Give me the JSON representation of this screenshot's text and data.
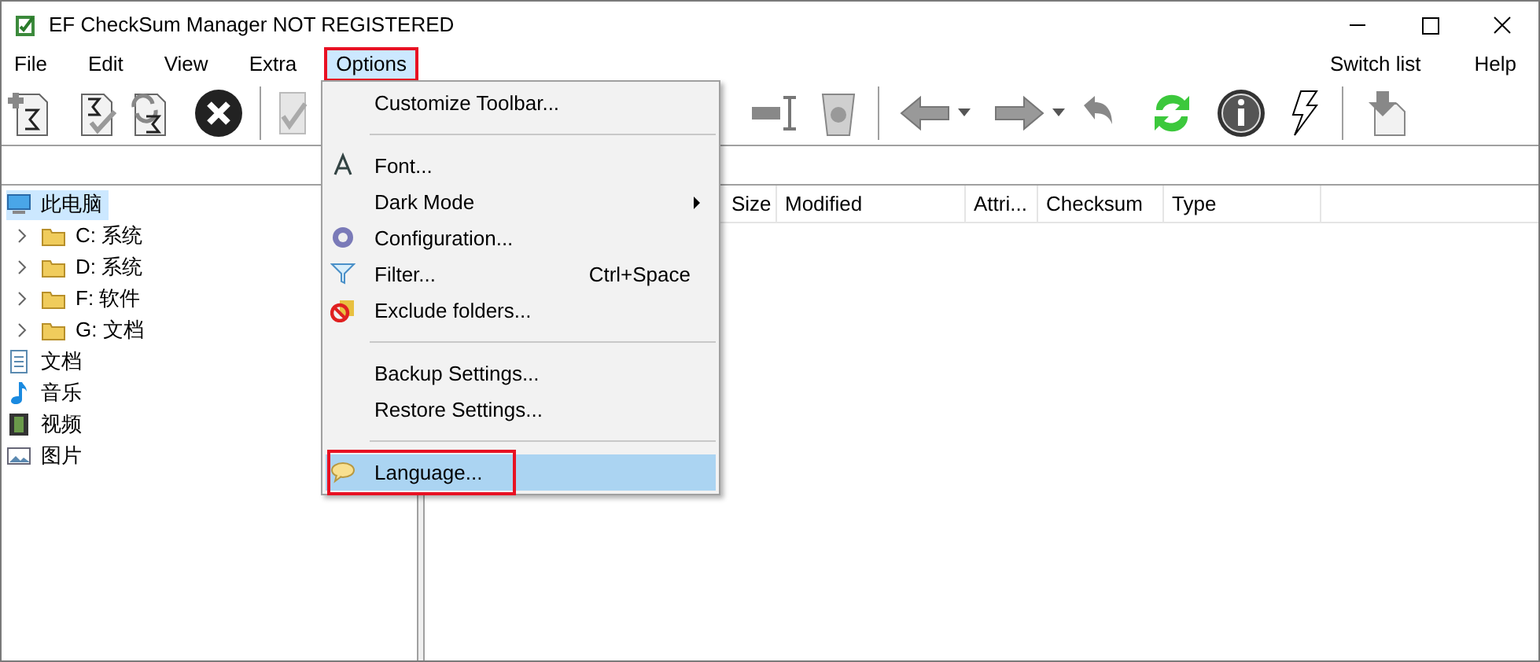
{
  "window": {
    "title": "EF CheckSum Manager NOT REGISTERED"
  },
  "menu_bar": [
    {
      "label": "File",
      "selected": false
    },
    {
      "label": "Edit",
      "selected": false
    },
    {
      "label": "View",
      "selected": false
    },
    {
      "label": "Extra",
      "selected": false
    },
    {
      "label": "Options",
      "selected": true
    }
  ],
  "menu_bar_right": [
    {
      "label": "Switch list",
      "selected": false
    },
    {
      "label": "Help",
      "selected": false
    }
  ],
  "options_menu": [
    {
      "kind": "item",
      "label": "Customize Toolbar...",
      "selected": false
    },
    {
      "kind": "separator"
    },
    {
      "kind": "item",
      "label": "Font...",
      "selected": false
    },
    {
      "kind": "item",
      "label": "Dark Mode",
      "submenu": true,
      "selected": false
    },
    {
      "kind": "item",
      "label": "Configuration...",
      "selected": false
    },
    {
      "kind": "item",
      "label": "Filter...",
      "shortcut": "Ctrl+Space",
      "selected": false
    },
    {
      "kind": "item",
      "label": "Exclude folders...",
      "selected": false
    },
    {
      "kind": "separator"
    },
    {
      "kind": "item",
      "label": "Backup Settings...",
      "selected": false
    },
    {
      "kind": "item",
      "label": "Restore Settings...",
      "selected": false
    },
    {
      "kind": "separator"
    },
    {
      "kind": "item",
      "label": "Language...",
      "selected": true
    }
  ],
  "tree": [
    {
      "label": "此电脑",
      "selected": true,
      "expanded": true,
      "children": [
        {
          "label": "C: 系统",
          "selected": false,
          "expanded": false
        },
        {
          "label": "D: 系统",
          "selected": false,
          "expanded": false
        },
        {
          "label": "F: 软件",
          "selected": false,
          "expanded": false
        },
        {
          "label": "G: 文档",
          "selected": false,
          "expanded": false
        }
      ]
    },
    {
      "label": "文档",
      "selected": false
    },
    {
      "label": "音乐",
      "selected": false
    },
    {
      "label": "视频",
      "selected": false
    },
    {
      "label": "图片",
      "selected": false
    }
  ],
  "file_list": {
    "columns": [
      "Size",
      "Modified",
      "Attri...",
      "Checksum",
      "Type"
    ]
  }
}
